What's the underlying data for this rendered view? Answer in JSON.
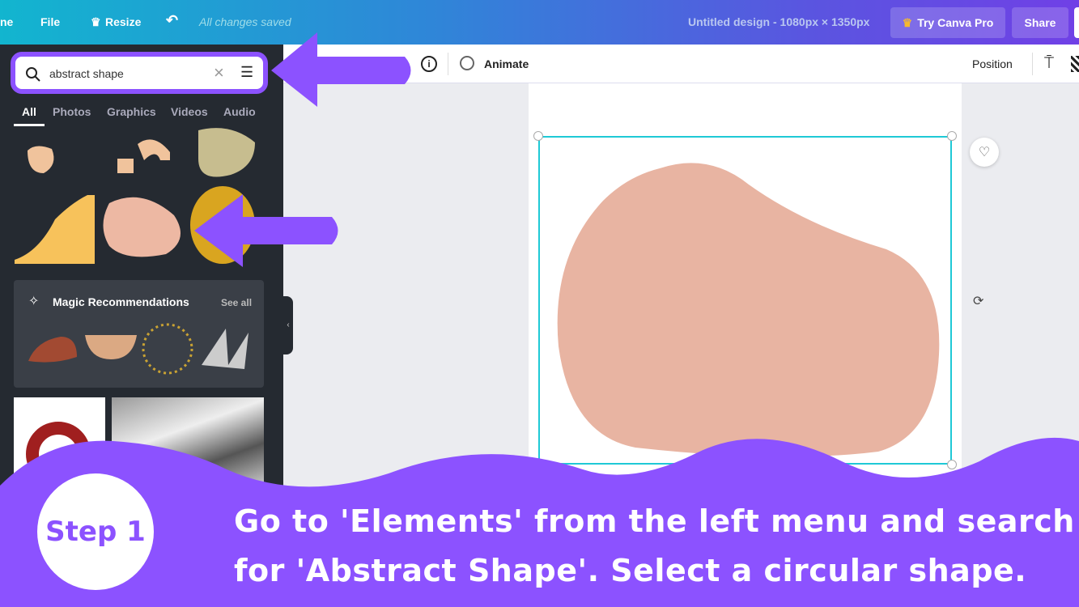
{
  "topbar": {
    "home_partial": "ne",
    "file": "File",
    "resize": "Resize",
    "saved": "All changes saved",
    "title": "Untitled design - 1080px × 1350px",
    "try_pro": "Try Canva Pro",
    "share": "Share"
  },
  "toolbar": {
    "animate": "Animate",
    "position": "Position"
  },
  "search": {
    "value": "abstract shape"
  },
  "tabs": [
    "All",
    "Photos",
    "Graphics",
    "Videos",
    "Audio"
  ],
  "magic": {
    "title": "Magic Recommendations",
    "see_all": "See all"
  },
  "colors": {
    "accent": "#8c52ff",
    "shape": "#e8b4a2",
    "selection": "#1fc9d6"
  },
  "tutorial": {
    "step": "Step 1",
    "line1": "Go to 'Elements' from the left menu and search",
    "line2": "for 'Abstract Shape'. Select a circular shape."
  }
}
